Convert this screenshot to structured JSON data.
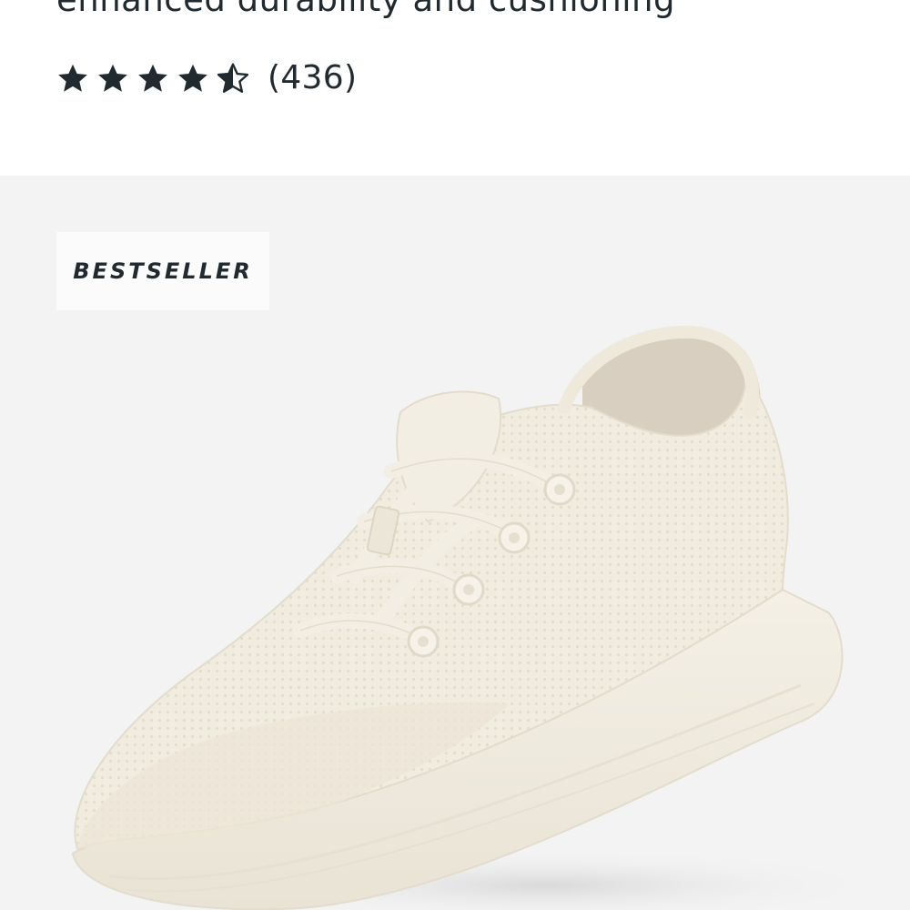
{
  "product": {
    "subtitle": "enhanced durability and cushioning",
    "rating": {
      "value": 4.5,
      "max": 5,
      "review_count_text": "(436)"
    },
    "badge": "BESTSELLER",
    "image": {
      "subject": "white knit sneaker"
    }
  },
  "colors": {
    "text": "#212a2f",
    "panel_bg": "#f3f3f3",
    "badge_bg": "#fbfbfb",
    "shoe": "#f1ece0"
  },
  "icons": {
    "full_star": "star-icon",
    "half_star": "half-star-icon"
  }
}
